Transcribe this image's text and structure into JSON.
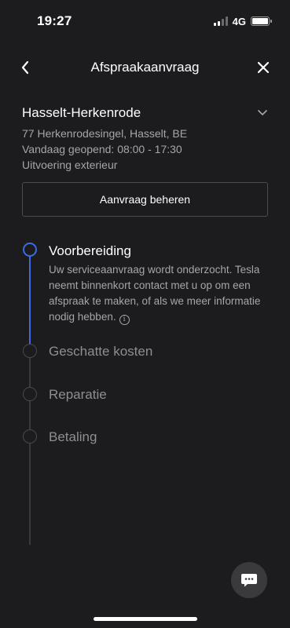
{
  "status_bar": {
    "time": "19:27",
    "network": "4G"
  },
  "header": {
    "title": "Afspraakaanvraag"
  },
  "location": {
    "name": "Hasselt-Herkenrode",
    "address": "77 Herkenrodesingel, Hasselt, BE",
    "hours": "Vandaag geopend: 08:00 - 17:30",
    "service_type": "Uitvoering exterieur"
  },
  "manage_button": {
    "label": "Aanvraag beheren"
  },
  "timeline": {
    "steps": [
      {
        "title": "Voorbereiding",
        "status": "active",
        "description": "Uw serviceaanvraag wordt onderzocht. Tesla neemt binnenkort contact met u op om een afspraak te maken, of als we meer informatie nodig hebben."
      },
      {
        "title": "Geschatte kosten",
        "status": "pending"
      },
      {
        "title": "Reparatie",
        "status": "pending"
      },
      {
        "title": "Betaling",
        "status": "pending"
      }
    ]
  },
  "colors": {
    "accent": "#3e6ae1",
    "background": "#1c1c1e"
  },
  "icons": [
    "back-icon",
    "close-icon",
    "chevron-down-icon",
    "info-icon",
    "chat-icon"
  ]
}
